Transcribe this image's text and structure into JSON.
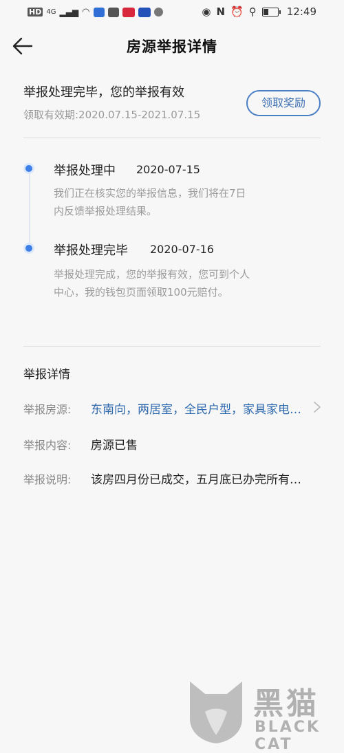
{
  "status_bar": {
    "time": "12:49",
    "network": "4G",
    "hd_label": "HD"
  },
  "nav": {
    "title": "房源举报详情"
  },
  "summary": {
    "title": "举报处理完毕，您的举报有效",
    "validity": "领取有效期:2020.07.15-2021.07.15",
    "claim_button": "领取奖励"
  },
  "timeline": [
    {
      "title": "举报处理中",
      "date": "2020-07-15",
      "desc_line1": "我们正在核实您的举报信息，我们将在7日",
      "desc_line2": "内反馈举报处理结果。"
    },
    {
      "title": "举报处理完毕",
      "date": "2020-07-16",
      "desc_line1": "举报处理完成，您的举报有效，您可到个人",
      "desc_line2": "中心，我的钱包页面领取100元赔付。"
    }
  ],
  "details": {
    "section_title": "举报详情",
    "rows": [
      {
        "label": "举报房源:",
        "value": "东南向，两居室，全民户型，家具家电齐全"
      },
      {
        "label": "举报内容:",
        "value": "房源已售"
      },
      {
        "label": "举报说明:",
        "value": "该房四月份已成交，五月底已办完所有手续"
      }
    ]
  },
  "watermark": {
    "name": "黑猫",
    "sub": "BLACK CAT"
  },
  "colors": {
    "accent": "#3d7fe6",
    "link": "#2f69ad",
    "button_border": "#4a7ec5"
  }
}
